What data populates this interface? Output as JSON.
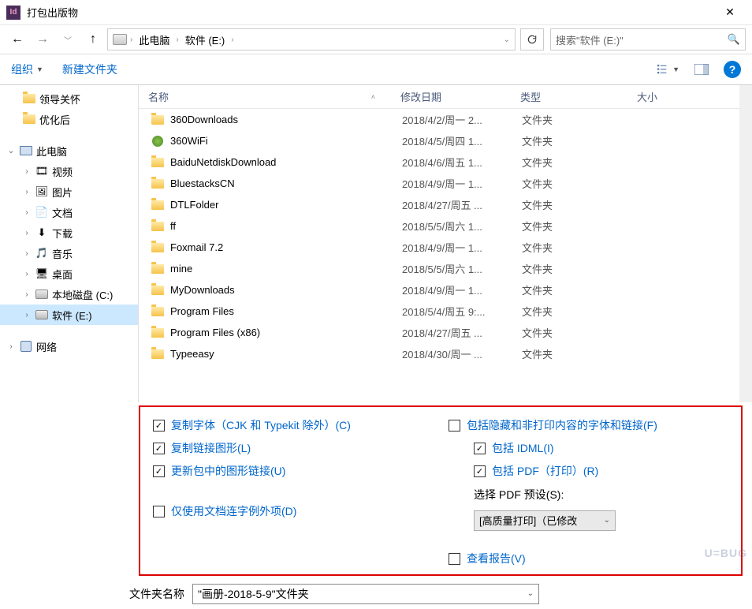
{
  "title": "打包出版物",
  "appIconText": "Id",
  "breadcrumbs": {
    "seg1": "此电脑",
    "seg2": "软件 (E:)"
  },
  "searchPlaceholder": "搜索\"软件 (E:)\"",
  "toolbar": {
    "organize": "组织",
    "newFolder": "新建文件夹"
  },
  "columns": {
    "name": "名称",
    "date": "修改日期",
    "type": "类型",
    "size": "大小"
  },
  "tree": {
    "item0": "领导关怀",
    "item1": "优化后",
    "pc": "此电脑",
    "video": "视频",
    "pictures": "图片",
    "documents": "文档",
    "downloads": "下载",
    "music": "音乐",
    "desktop": "桌面",
    "localdisk": "本地磁盘 (C:)",
    "softdisk": "软件 (E:)",
    "network": "网络"
  },
  "files": [
    {
      "name": "360Downloads",
      "date": "2018/4/2/周一 2...",
      "type": "文件夹",
      "icon": "folder"
    },
    {
      "name": "360WiFi",
      "date": "2018/4/5/周四 1...",
      "type": "文件夹",
      "icon": "wifi"
    },
    {
      "name": "BaiduNetdiskDownload",
      "date": "2018/4/6/周五 1...",
      "type": "文件夹",
      "icon": "folder"
    },
    {
      "name": "BluestacksCN",
      "date": "2018/4/9/周一 1...",
      "type": "文件夹",
      "icon": "folder"
    },
    {
      "name": "DTLFolder",
      "date": "2018/4/27/周五 ...",
      "type": "文件夹",
      "icon": "folder"
    },
    {
      "name": "ff",
      "date": "2018/5/5/周六 1...",
      "type": "文件夹",
      "icon": "folder"
    },
    {
      "name": "Foxmail 7.2",
      "date": "2018/4/9/周一 1...",
      "type": "文件夹",
      "icon": "folder"
    },
    {
      "name": "mine",
      "date": "2018/5/5/周六 1...",
      "type": "文件夹",
      "icon": "folder"
    },
    {
      "name": "MyDownloads",
      "date": "2018/4/9/周一 1...",
      "type": "文件夹",
      "icon": "folder"
    },
    {
      "name": "Program Files",
      "date": "2018/5/4/周五 9:...",
      "type": "文件夹",
      "icon": "folder"
    },
    {
      "name": "Program Files (x86)",
      "date": "2018/4/27/周五 ...",
      "type": "文件夹",
      "icon": "folder"
    },
    {
      "name": "Typeeasy",
      "date": "2018/4/30/周一 ...",
      "type": "文件夹",
      "icon": "folder"
    }
  ],
  "options": {
    "copyFonts": "复制字体（CJK 和 Typekit 除外）(C)",
    "copyLinkedGraphics": "复制链接图形(L)",
    "updateGraphicLinks": "更新包中的图形链接(U)",
    "useDocHyphenation": "仅使用文档连字例外项(D)",
    "includeHidden": "包括隐藏和非打印内容的字体和链接(F)",
    "includeIDML": "包括 IDML(I)",
    "includePDF": "包括 PDF（打印）(R)",
    "selectPdfPreset": "选择 PDF 预设(S):",
    "presetValue": "[高质量打印]（已修改",
    "viewReport": "查看报告(V)"
  },
  "checks": {
    "copyFonts": true,
    "copyLinkedGraphics": true,
    "updateGraphicLinks": true,
    "useDocHyphenation": false,
    "includeHidden": false,
    "includeIDML": true,
    "includePDF": true,
    "viewReport": false
  },
  "folderNameLabel": "文件夹名称",
  "folderNameValue": "\"画册-2018-5-9\"文件夹",
  "watermark": "U=BUG"
}
